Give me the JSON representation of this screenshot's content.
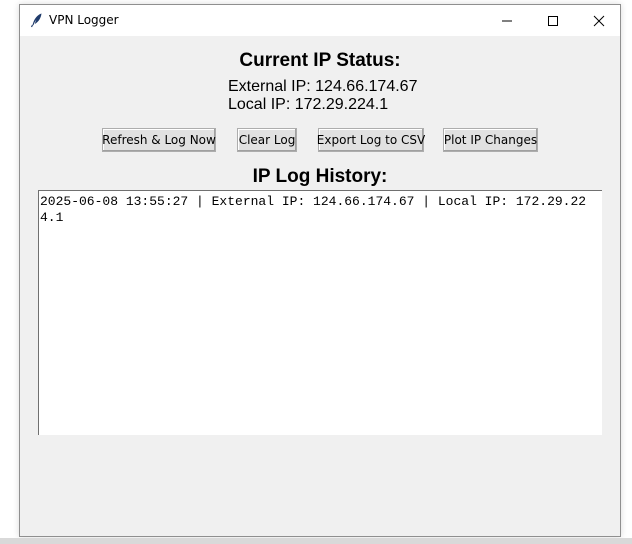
{
  "window": {
    "title": "VPN Logger"
  },
  "status": {
    "heading": "Current IP Status:",
    "external_ip_line": "External IP: 124.66.174.67",
    "local_ip_line": "Local IP: 172.29.224.1"
  },
  "toolbar": {
    "refresh_label": "Refresh & Log Now",
    "clear_label": "Clear Log",
    "export_label": "Export Log to CSV",
    "plot_label": "Plot IP Changes"
  },
  "log": {
    "heading": "IP Log History:",
    "entries": [
      "2025-06-08 13:55:27 | External IP: 124.66.174.67 | Local IP: 172.29.224.1"
    ],
    "text": "2025-06-08 13:55:27 | External IP: 124.66.174.67 | Local IP: 172.29.224.1"
  },
  "icons": {
    "app": "feather-icon",
    "minimize": "minimize-icon",
    "maximize": "maximize-icon",
    "close": "close-icon"
  }
}
